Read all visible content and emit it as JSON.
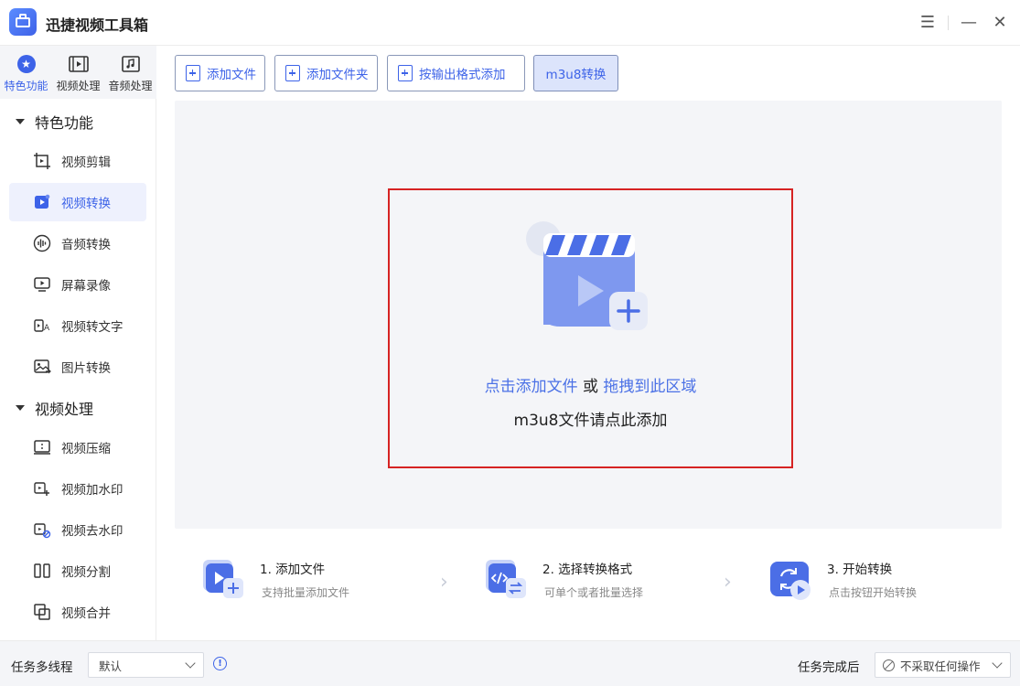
{
  "app": {
    "title": "迅捷视频工具箱"
  },
  "window_controls": {
    "menu": "☰",
    "minimize": "—",
    "close": "✕"
  },
  "top_tabs": [
    {
      "label": "特色功能",
      "icon": "star-icon",
      "active": true
    },
    {
      "label": "视频处理",
      "icon": "film-icon",
      "active": false
    },
    {
      "label": "音频处理",
      "icon": "music-icon",
      "active": false
    }
  ],
  "sidebar": {
    "groups": [
      {
        "label": "特色功能",
        "items": [
          {
            "label": "视频剪辑",
            "icon": "crop-video-icon"
          },
          {
            "label": "视频转换",
            "icon": "video-convert-icon",
            "active": true
          },
          {
            "label": "音频转换",
            "icon": "audio-wave-icon"
          },
          {
            "label": "屏幕录像",
            "icon": "screen-record-icon"
          },
          {
            "label": "视频转文字",
            "icon": "video-to-text-icon"
          },
          {
            "label": "图片转换",
            "icon": "image-convert-icon"
          }
        ]
      },
      {
        "label": "视频处理",
        "items": [
          {
            "label": "视频压缩",
            "icon": "compress-icon"
          },
          {
            "label": "视频加水印",
            "icon": "add-watermark-icon"
          },
          {
            "label": "视频去水印",
            "icon": "remove-watermark-icon"
          },
          {
            "label": "视频分割",
            "icon": "split-icon"
          },
          {
            "label": "视频合并",
            "icon": "merge-icon"
          }
        ]
      }
    ]
  },
  "toolbar": {
    "add_file": "添加文件",
    "add_folder": "添加文件夹",
    "add_by_format": "按输出格式添加",
    "m3u8": "m3u8转换"
  },
  "dropzone": {
    "link_click": "点击添加文件",
    "or": "或",
    "link_drag": "拖拽到此区域",
    "m3u8_hint": "m3u8文件请点此添加"
  },
  "steps": [
    {
      "title": "1. 添加文件",
      "sub": "支持批量添加文件"
    },
    {
      "title": "2. 选择转换格式",
      "sub": "可单个或者批量选择"
    },
    {
      "title": "3. 开始转换",
      "sub": "点击按钮开始转换"
    }
  ],
  "bottom": {
    "multithread_label": "任务多线程",
    "multithread_value": "默认",
    "after_label": "任务完成后",
    "after_value": "不采取任何操作"
  },
  "colors": {
    "accent": "#3d63e8",
    "highlight_border": "#d62323",
    "active_bg": "#eef1fd"
  }
}
